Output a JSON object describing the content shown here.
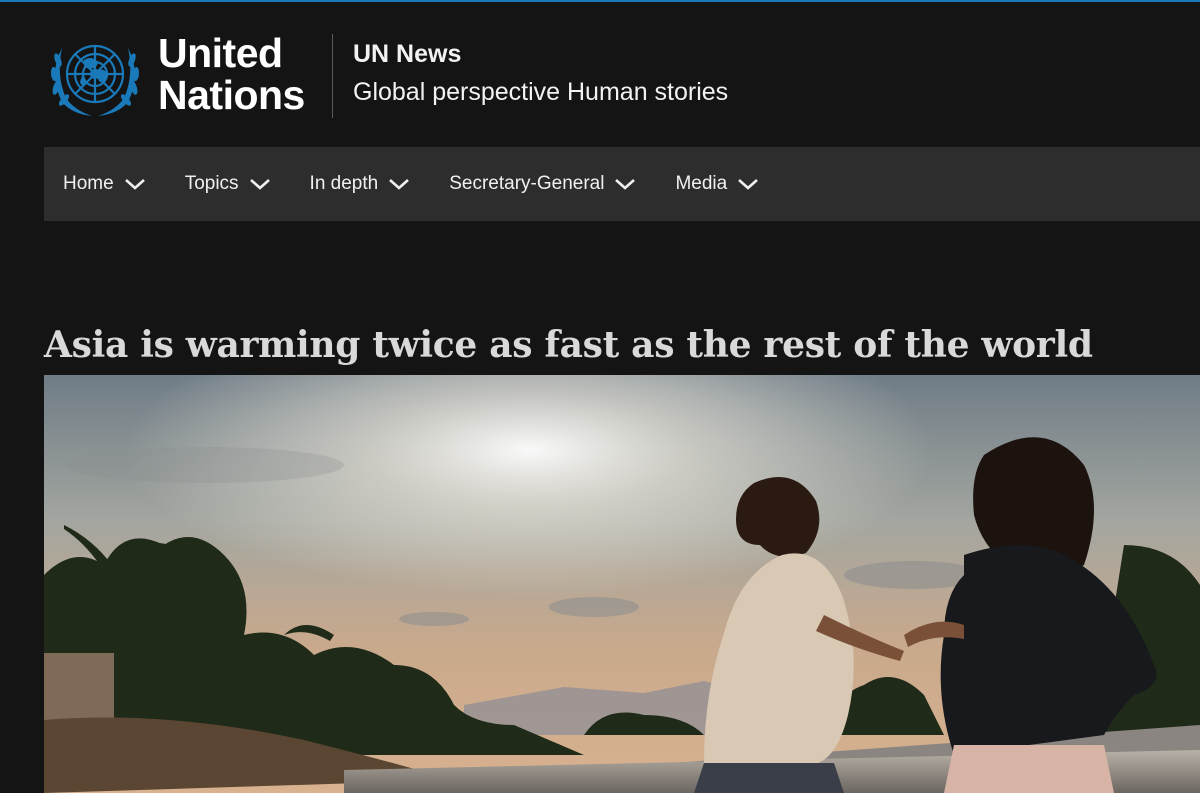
{
  "header": {
    "org_name_line1": "United",
    "org_name_line2": "Nations",
    "site_title": "UN News",
    "site_tagline": "Global perspective Human stories",
    "emblem_icon": "un-emblem-icon",
    "brand_color": "#1a79b8"
  },
  "nav": {
    "items": [
      {
        "label": "Home",
        "icon": "chevron-down-icon"
      },
      {
        "label": "Topics",
        "icon": "chevron-down-icon"
      },
      {
        "label": "In depth",
        "icon": "chevron-down-icon"
      },
      {
        "label": "Secretary-General",
        "icon": "chevron-down-icon"
      },
      {
        "label": "Media",
        "icon": "chevron-down-icon"
      }
    ]
  },
  "article": {
    "headline": "Asia is warming twice as fast as the rest of the world"
  }
}
